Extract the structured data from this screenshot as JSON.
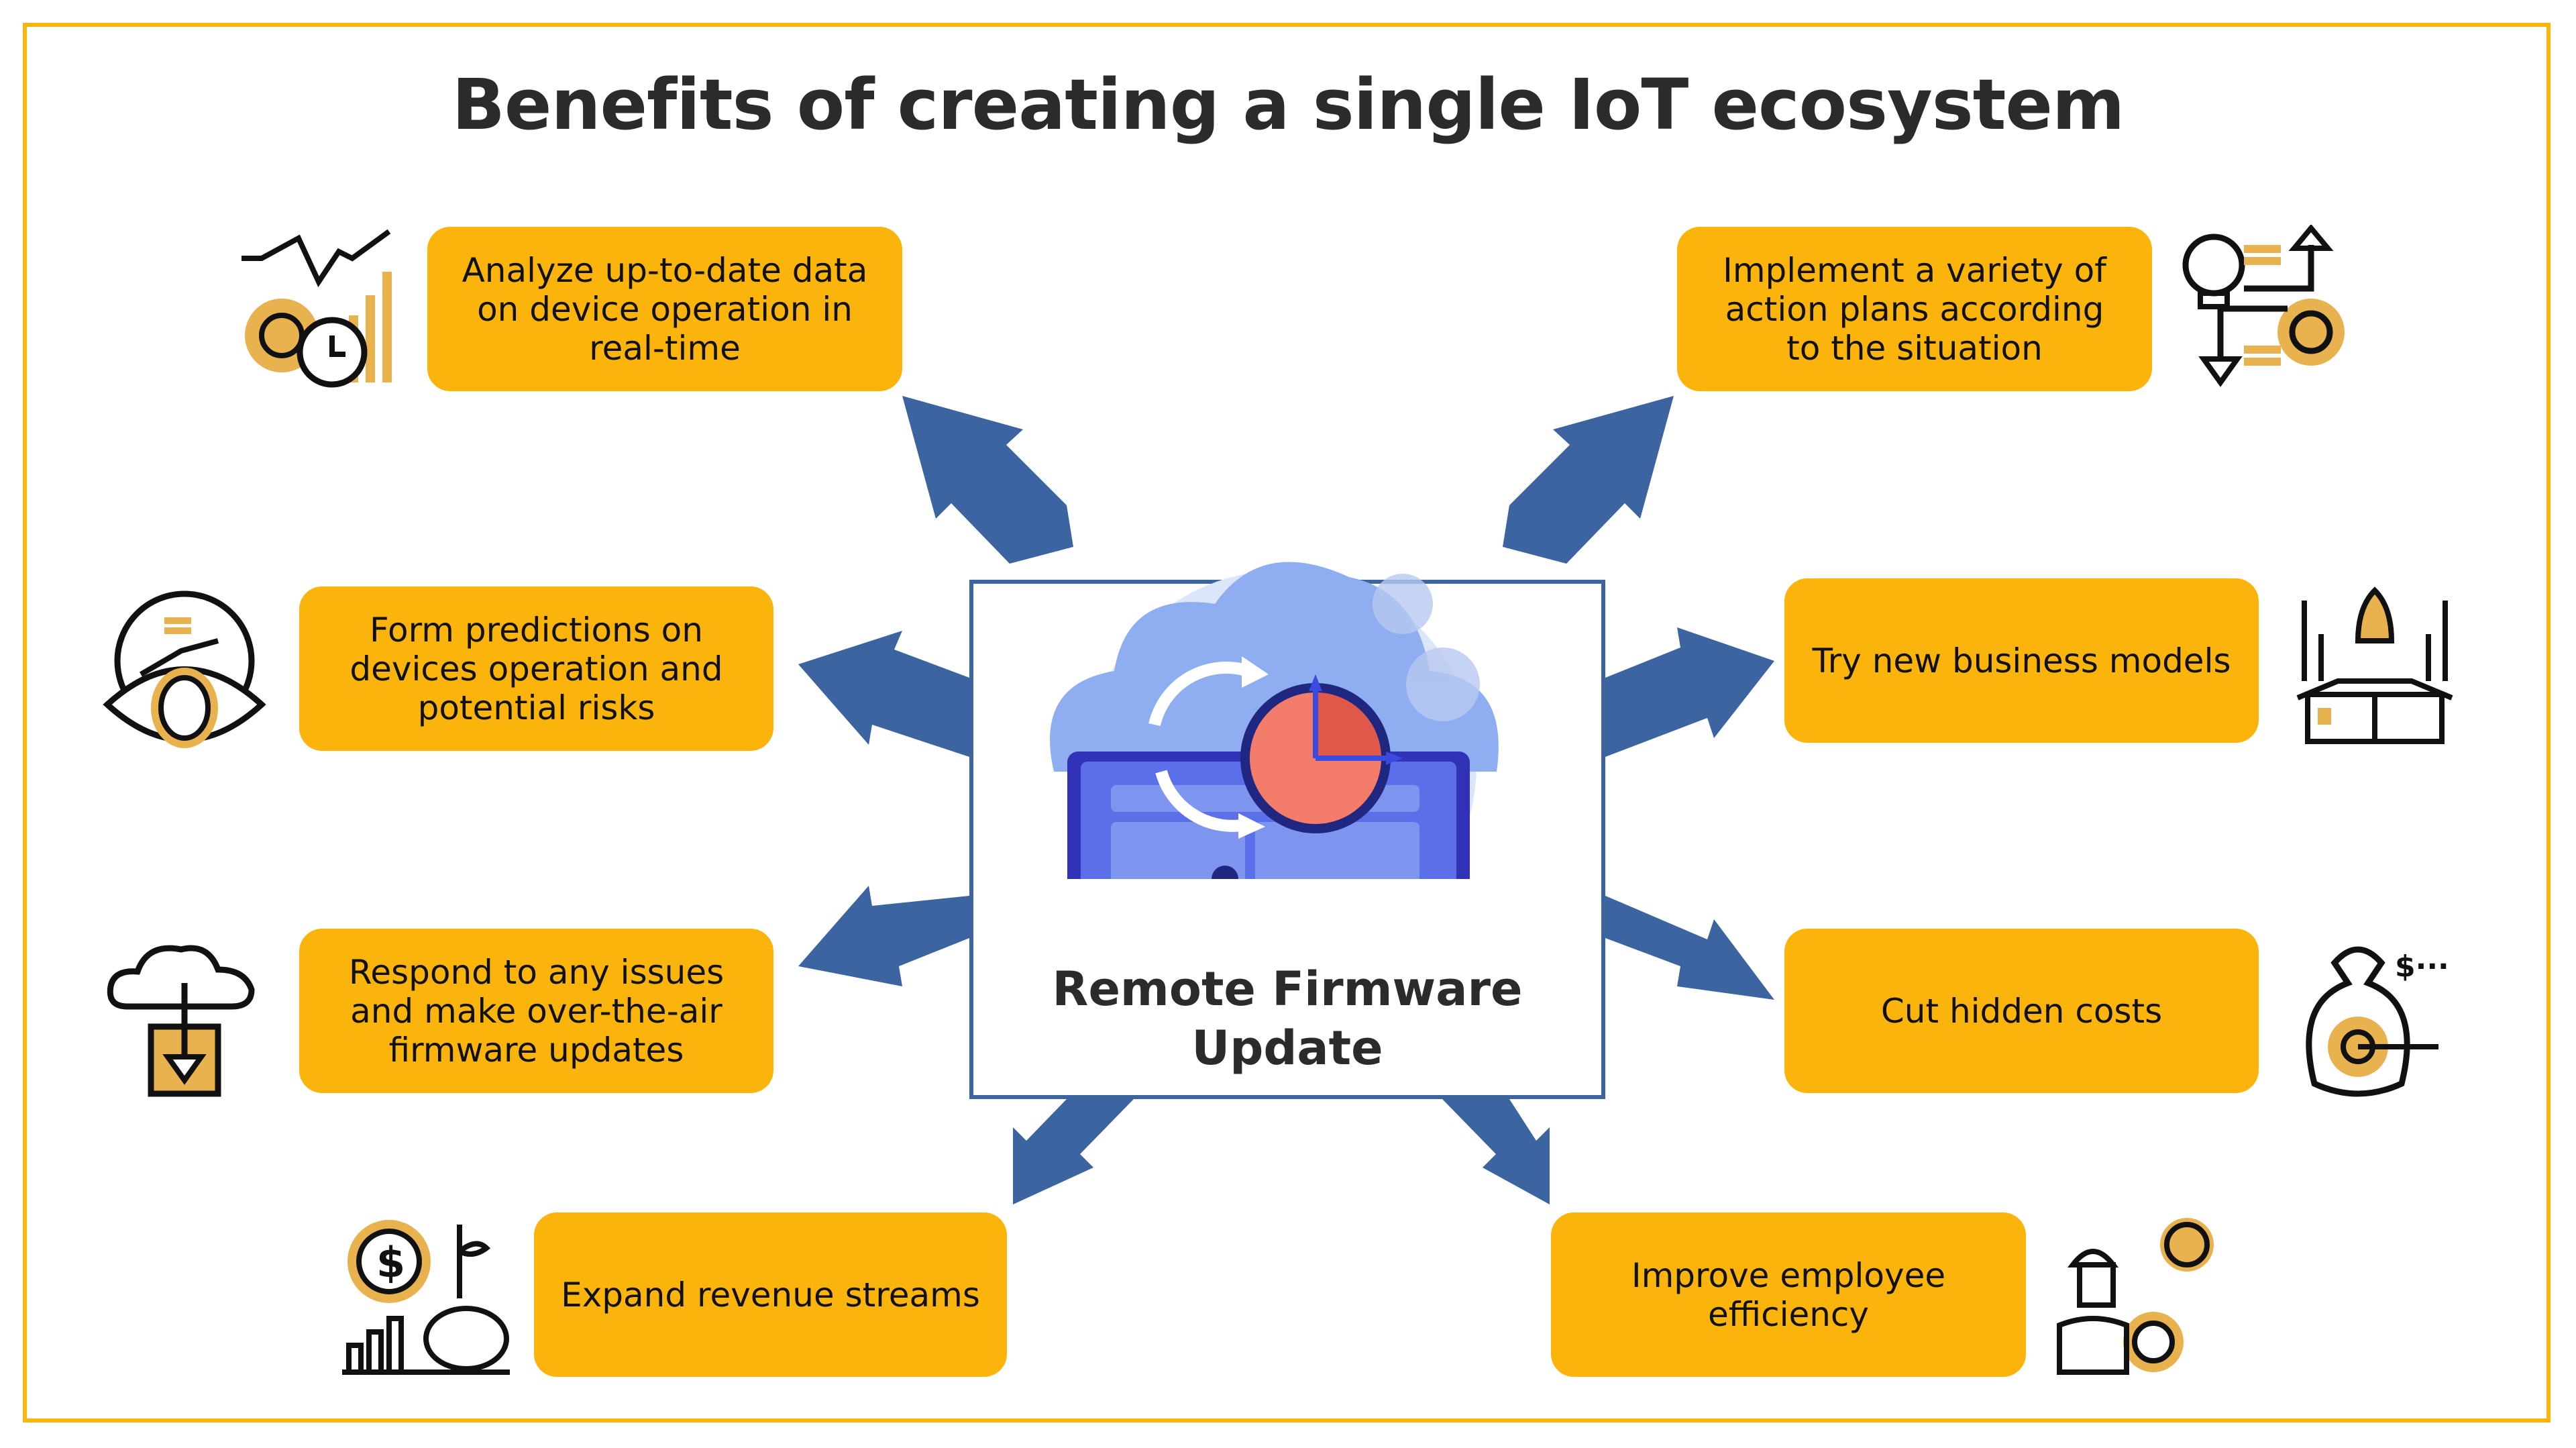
{
  "title": "Benefits of creating a single IoT ecosystem",
  "center": {
    "label_line1": "Remote Firmware",
    "label_line2": "Update",
    "illustration": "laptop-cloud-clock-illustration"
  },
  "benefits": [
    {
      "text": "Analyze up-to-date data on device operation in real-time",
      "icon": "analytics-gear-clock-icon",
      "side": "left"
    },
    {
      "text": "Implement a variety of action plans according to the situation",
      "icon": "idea-action-plan-icon",
      "side": "right"
    },
    {
      "text": "Form predictions on devices operation and potential risks",
      "icon": "prediction-eye-icon",
      "side": "left"
    },
    {
      "text": "Try new business models",
      "icon": "rocket-startup-icon",
      "side": "right"
    },
    {
      "text": "Respond to any issues and make over-the-air firmware updates",
      "icon": "cloud-download-chip-icon",
      "side": "left"
    },
    {
      "text": "Cut hidden costs",
      "icon": "money-bag-target-icon",
      "side": "right"
    },
    {
      "text": "Expand revenue streams",
      "icon": "piggy-bank-growth-icon",
      "side": "left"
    },
    {
      "text": "Improve employee efficiency",
      "icon": "worker-idea-icon",
      "side": "right"
    }
  ],
  "colors": {
    "accent_yellow": "#FBB40B",
    "arrow_blue": "#3B64A1",
    "icon_gold": "#E8B24F",
    "text_dark": "#2b2b2b"
  }
}
